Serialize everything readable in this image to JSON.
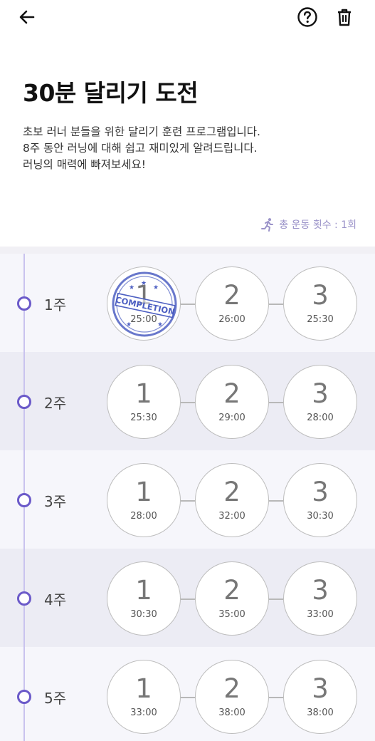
{
  "header": {
    "title": "30분 달리기 도전",
    "description": [
      "초보 러너 분들을 위한 달리기 훈련 프로그램입니다.",
      "8주 동안 러닝에 대해 쉽고 재미있게 알려드립니다.",
      "러닝의 매력에 빠져보세요!"
    ]
  },
  "total": {
    "label": "총 운동 횟수 : 1회"
  },
  "colors": {
    "accent": "#6b5ac9",
    "stamp": "#4d5fc2",
    "timeline": "#c9c3ee"
  },
  "icons": {
    "back": "arrow-left-icon",
    "help": "question-circle-icon",
    "delete": "trash-icon",
    "run": "runner-icon"
  },
  "stamp": {
    "text": "COMPLETION"
  },
  "weeks": [
    {
      "label": "1주",
      "days": [
        {
          "num": "1",
          "time": "25:00",
          "completed": true
        },
        {
          "num": "2",
          "time": "26:00"
        },
        {
          "num": "3",
          "time": "25:30"
        }
      ]
    },
    {
      "label": "2주",
      "days": [
        {
          "num": "1",
          "time": "25:30"
        },
        {
          "num": "2",
          "time": "29:00"
        },
        {
          "num": "3",
          "time": "28:00"
        }
      ]
    },
    {
      "label": "3주",
      "days": [
        {
          "num": "1",
          "time": "28:00"
        },
        {
          "num": "2",
          "time": "32:00"
        },
        {
          "num": "3",
          "time": "30:30"
        }
      ]
    },
    {
      "label": "4주",
      "days": [
        {
          "num": "1",
          "time": "30:30"
        },
        {
          "num": "2",
          "time": "35:00"
        },
        {
          "num": "3",
          "time": "33:00"
        }
      ]
    },
    {
      "label": "5주",
      "days": [
        {
          "num": "1",
          "time": "33:00"
        },
        {
          "num": "2",
          "time": "38:00"
        },
        {
          "num": "3",
          "time": "38:00"
        }
      ]
    }
  ]
}
